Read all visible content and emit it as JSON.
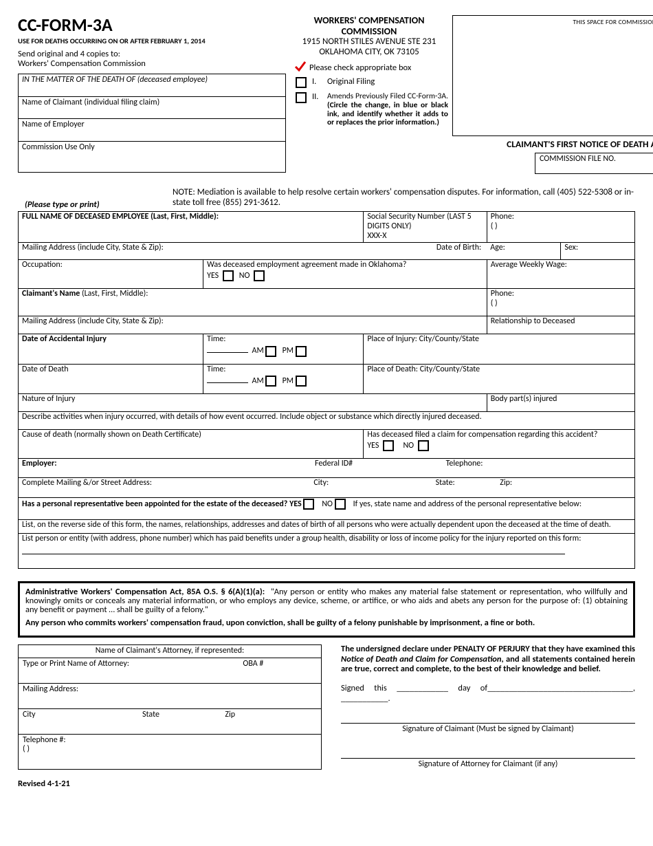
{
  "header": {
    "form_id": "CC-FORM-3A",
    "sub": "USE FOR DEATHS OCCURRING ON OR AFTER FEBRUARY 1, 2014",
    "agency": "WORKERS' COMPENSATION COMMISSION",
    "addr1": "1915 NORTH STILES AVENUE STE 231",
    "addr2": "OKLAHOMA CITY, OK 73105",
    "use_only": "THIS SPACE FOR COMMISSION USE ONLY",
    "send_to_1": "Send original and 4 copies to:",
    "send_to_2": "Workers' Compensation Commission",
    "matter": "IN THE MATTER OF THE DEATH OF (deceased employee)",
    "claimant": "Name of Claimant (individual filing claim)",
    "employer": "Name of Employer",
    "commission_use": "Commission Use Only",
    "check_instr": "Please check appropriate box",
    "opt1_num": "I.",
    "opt1": "Original Filing",
    "opt2_num": "II.",
    "opt2": "Amends Previously Filed CC-Form-3A. (Circle the change, in blue or black ink, and identify whether it adds to or replaces the prior information.)",
    "title": "CLAIMANT'S FIRST NOTICE OF DEATH AND CLAIM FOR COMPENSATION",
    "file_no": "COMMISSION FILE NO."
  },
  "note": {
    "lead": "NOTE:",
    "body": "Mediation is available to help resolve certain workers' compensation disputes. For information, call (405) 522-5308 or in-state toll free (855) 291-3612.",
    "please": "(Please type or print)"
  },
  "f": {
    "full_name": "FULL NAME OF DECEASED EMPLOYEE (Last, First, Middle):",
    "ssn1": "Social Security Number (LAST 5 DIGITS ONLY)",
    "ssn2": "XXX-X",
    "phone": "Phone:",
    "paren": "(            )",
    "mail_addr": "Mailing Address (include City, State & Zip):",
    "dob": "Date of Birth:",
    "age": "Age:",
    "sex": "Sex:",
    "occupation": "Occupation:",
    "agreement_q": "Was deceased employment agreement made in Oklahoma?",
    "yes": "YES",
    "no": "NO",
    "avg_wage": "Average Weekly Wage:",
    "claimant_name": "Claimant's Name (Last, First, Middle):",
    "relationship": "Relationship to Deceased",
    "date_injury": "Date of Accidental Injury",
    "time": "Time:",
    "am": "AM",
    "pm": "PM",
    "place_injury": "Place of Injury:   City/County/State",
    "date_death": "Date of Death",
    "place_death": "Place of Death:   City/County/State",
    "nature": "Nature of Injury",
    "body_part": "Body part(s) injured",
    "describe": "Describe activities when injury occurred, with details of how event occurred.  Include object or substance which directly injured deceased.",
    "cause": "Cause of death (normally shown on Death Certificate)",
    "prior_claim_q": "Has deceased filed a claim for compensation regarding this accident?",
    "employer_lbl": "Employer:",
    "fed_id": "Federal ID#",
    "telephone": "Telephone:",
    "complete_addr": "Complete Mailing &/or Street Address:",
    "city": "City:",
    "state": "State:",
    "zip": "Zip:",
    "rep_q": "Has a personal representative been appointed for the estate of the deceased?  YES",
    "rep_q2": "NO",
    "rep_q3": "If yes, state name and address of the personal  representative below:",
    "list_reverse": "List, on the reverse side of this form, the names, relationships, addresses and dates of birth of all persons who were actually dependent upon the deceased at the time of death.",
    "list_benefits": "List person or entity (with address, phone number) which has paid benefits under a group health, disability or loss of income policy for the injury reported on this form:"
  },
  "legal": {
    "citation": "Administrative Workers' Compensation Act, 85A O.S. § 6(A)(1)(a):",
    "p1": "\"Any person or entity who makes any material false statement or representation, who willfully and knowingly omits or conceals any material information, or who employs any device, scheme, or  artifice, or who aids and abets any person for the purpose of: (1) obtaining any benefit or payment … shall be guilty of a felony.\"",
    "p2": "Any person who commits workers' compensation fraud, upon conviction, shall be guilty of a felony punishable by imprisonment, a fine or both."
  },
  "atty": {
    "hdr": "Name of Claimant's Attorney, if represented:",
    "name": "Type or Print Name of Attorney:",
    "oba": "OBA #",
    "mail": "Mailing Address:",
    "city": "City",
    "state": "State",
    "zip": "Zip",
    "phone": "Telephone #:",
    "paren": "(            )"
  },
  "decl": {
    "p1a": "The undersigned declare under PENALTY OF PERJURY that they have examined this ",
    "p1b": "Notice of Death and Claim for Compensation",
    "p1c": ", and all statements contained herein are true, correct and complete, to the best of their knowledge and belief.",
    "signed": "Signed this ____________ day of__________________________________, ___________.",
    "sig1": "Signature of Claimant (Must be signed by Claimant)",
    "sig2": "Signature of Attorney for Claimant (if any)"
  },
  "revised": "Revised 4-1-21"
}
